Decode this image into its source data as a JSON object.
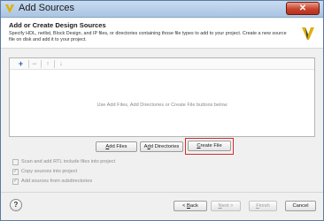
{
  "window": {
    "title": "Add Sources",
    "close_label": "✕"
  },
  "header": {
    "title": "Add or Create Design Sources",
    "description": "Specify HDL, netlist, Block Design, and IP files, or directories containing those file types to add to your project. Create a new source file on disk and add it to your project."
  },
  "toolbar": {
    "add_icon": "+",
    "remove_icon": "−",
    "up_icon": "↑",
    "down_icon": "↓"
  },
  "files_panel": {
    "empty_hint": "Use Add Files, Add Directories or Create File buttons below"
  },
  "buttons": {
    "add_files": {
      "key": "A",
      "rest": "dd Files"
    },
    "add_directories": {
      "pre": "A",
      "key": "d",
      "rest": "d Directories"
    },
    "create_file": {
      "key": "C",
      "rest": "reate File"
    }
  },
  "options": [
    {
      "label": "Scan and add RTL include files into project",
      "checked": false
    },
    {
      "label": "Copy sources into project",
      "checked": true
    },
    {
      "label": "Add sources from subdirectories",
      "checked": true
    }
  ],
  "footer": {
    "help": "?",
    "back": {
      "pre": "< ",
      "key": "B",
      "rest": "ack"
    },
    "next": {
      "key": "N",
      "rest": "ext >"
    },
    "finish": {
      "key": "F",
      "rest": "inish"
    },
    "cancel": "Cancel"
  },
  "colors": {
    "highlight": "#d42d2d",
    "titlebar": "#a9c4e3",
    "close": "#c8432d",
    "logo": "#e0b000"
  }
}
